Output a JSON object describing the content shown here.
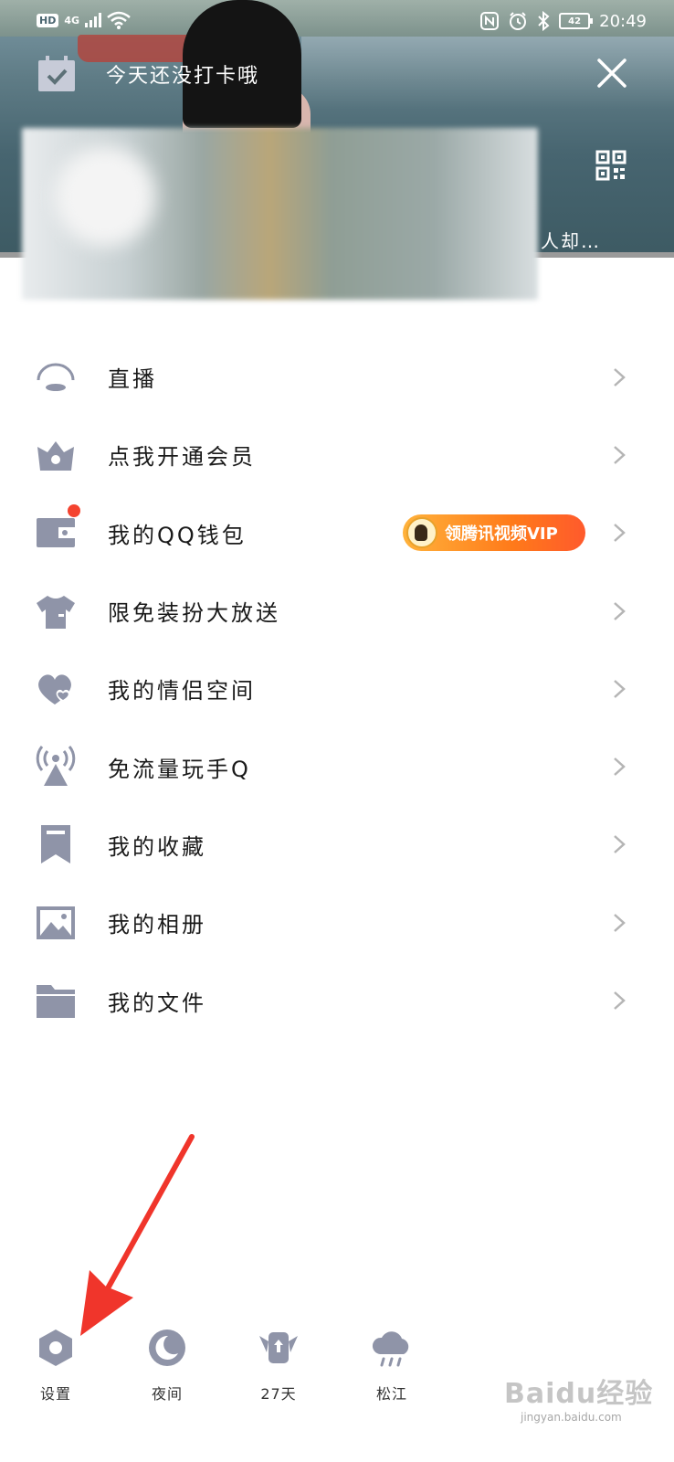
{
  "status_bar": {
    "hd": "HD",
    "network": "4G",
    "battery": "42",
    "time": "20:49"
  },
  "header": {
    "checkin_text": "今天还没打卡哦",
    "signature_text": "人却…"
  },
  "menu": {
    "items": [
      {
        "label": "直播",
        "icon": "live-icon"
      },
      {
        "label": "点我开通会员",
        "icon": "vip-crown-icon"
      },
      {
        "label": "我的QQ钱包",
        "icon": "wallet-icon",
        "badge": "领腾讯视频VIP",
        "has_dot": true
      },
      {
        "label": "限免装扮大放送",
        "icon": "shirt-icon"
      },
      {
        "label": "我的情侣空间",
        "icon": "hearts-icon"
      },
      {
        "label": "免流量玩手Q",
        "icon": "signal-tower-icon"
      },
      {
        "label": "我的收藏",
        "icon": "bookmark-icon"
      },
      {
        "label": "我的相册",
        "icon": "photo-icon"
      },
      {
        "label": "我的文件",
        "icon": "folder-icon"
      }
    ]
  },
  "bottom_bar": {
    "settings_label": "设置",
    "night_label": "夜间",
    "days_label": "27天",
    "weather_label": "松江"
  },
  "watermark": {
    "logo": "Baidu经验",
    "url": "jingyan.baidu.com"
  },
  "colors": {
    "icon": "#8f94a8",
    "accent_orange": "#ff7a1a",
    "arrow_red": "#f0352b",
    "badge_dot": "#f4432f"
  }
}
